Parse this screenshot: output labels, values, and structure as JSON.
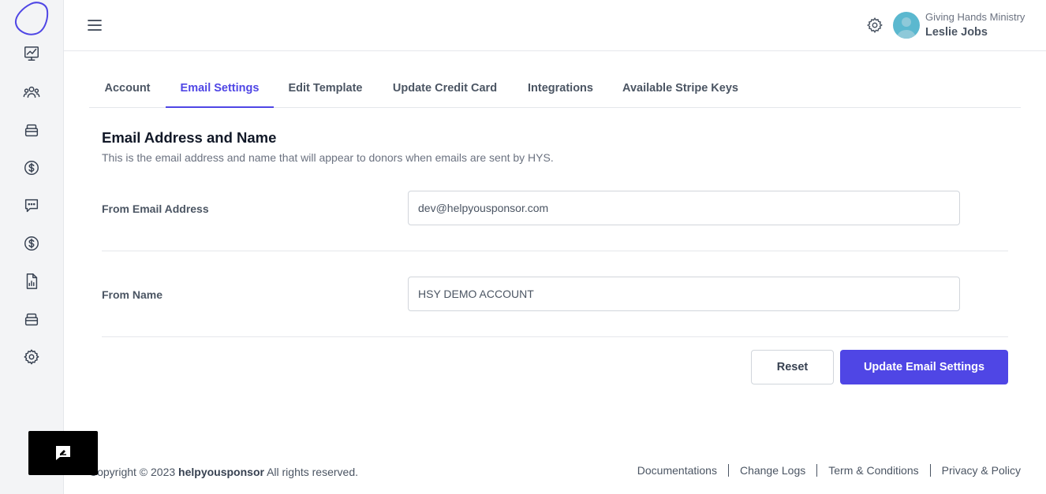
{
  "header": {
    "org_name": "Giving Hands Ministry",
    "user_name": "Leslie Jobs"
  },
  "tabs": [
    {
      "label": "Account",
      "active": false
    },
    {
      "label": "Email Settings",
      "active": true
    },
    {
      "label": "Edit Template",
      "active": false
    },
    {
      "label": "Update Credit Card",
      "active": false
    },
    {
      "label": "Integrations",
      "active": false
    },
    {
      "label": "Available Stripe Keys",
      "active": false
    }
  ],
  "section": {
    "title": "Email Address and Name",
    "description": "This is the email address and name that will appear to donors when emails are sent by HYS."
  },
  "form": {
    "email_label": "From Email Address",
    "email_value": "dev@helpyousponsor.com",
    "name_label": "From Name",
    "name_value": "HSY DEMO ACCOUNT"
  },
  "buttons": {
    "reset": "Reset",
    "update": "Update Email Settings"
  },
  "footer": {
    "copy_prefix": "Copyright © 2023 ",
    "brand": "helpyousponsor",
    "copy_suffix": " All rights reserved.",
    "links": [
      "Documentations",
      "Change Logs",
      "Term & Conditions",
      "Privacy & Policy"
    ]
  },
  "colors": {
    "accent": "#4f46e5",
    "sidebar_bg": "#f3f4f6"
  },
  "icons": {
    "sidebar": [
      "chart-icon",
      "users-icon",
      "box-icon",
      "dollar-icon",
      "chat-icon",
      "dollar-icon",
      "report-icon",
      "box-icon",
      "gear-icon"
    ]
  }
}
